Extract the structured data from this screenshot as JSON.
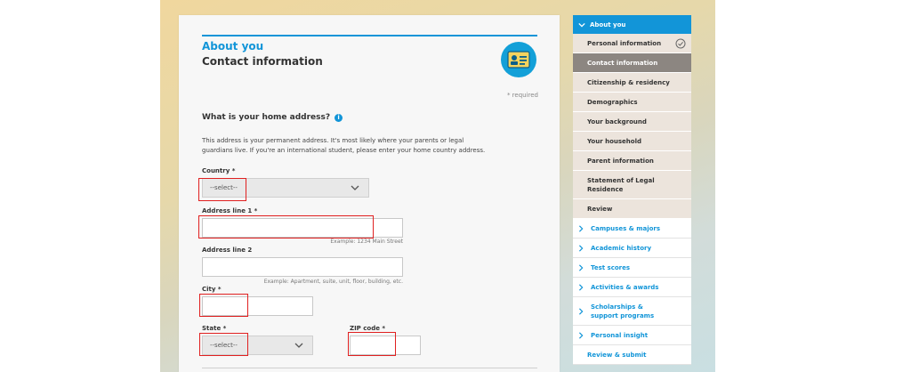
{
  "form": {
    "kicker": "About you",
    "title": "Contact information",
    "required_note": "* required",
    "question": "What is your home address?",
    "info_glyph": "i",
    "description": "This address is your permanent address. It's most likely where your parents or legal guardians live. If you're an international student, please enter your home country address.",
    "country": {
      "label": "Country *",
      "value": "--select--"
    },
    "address1": {
      "label": "Address line 1 *",
      "value": "",
      "example": "Example: 1234 Main Street"
    },
    "address2": {
      "label": "Address line 2",
      "value": "",
      "example": "Example: Apartment, suite, unit, floor, building, etc."
    },
    "city": {
      "label": "City *",
      "value": ""
    },
    "state": {
      "label": "State *",
      "value": "--select--"
    },
    "zip": {
      "label": "ZIP code *",
      "value": ""
    }
  },
  "nav": {
    "section": "About you",
    "subitems": [
      {
        "label": "Personal information",
        "state": "completed"
      },
      {
        "label": "Contact information",
        "state": "active"
      },
      {
        "label": "Citizenship & residency",
        "state": ""
      },
      {
        "label": "Demographics",
        "state": ""
      },
      {
        "label": "Your background",
        "state": ""
      },
      {
        "label": "Your household",
        "state": ""
      },
      {
        "label": "Parent information",
        "state": ""
      },
      {
        "label": "Statement of Legal Residence",
        "state": ""
      },
      {
        "label": "Review",
        "state": ""
      }
    ],
    "main_items": [
      {
        "label": "Campuses & majors"
      },
      {
        "label": "Academic history"
      },
      {
        "label": "Test scores"
      },
      {
        "label": "Activities & awards"
      },
      {
        "label": "Scholarships & support programs"
      },
      {
        "label": "Personal insight"
      },
      {
        "label": "Review & submit"
      }
    ]
  },
  "colors": {
    "accent": "#1295d8",
    "active_nav": "#8c8681",
    "subnav_bg": "#ece4dc",
    "highlight": "#e02020"
  },
  "icons": [
    "id-card-icon",
    "info-icon",
    "chevron-down-icon",
    "chevron-right-icon",
    "check-circle-icon"
  ]
}
